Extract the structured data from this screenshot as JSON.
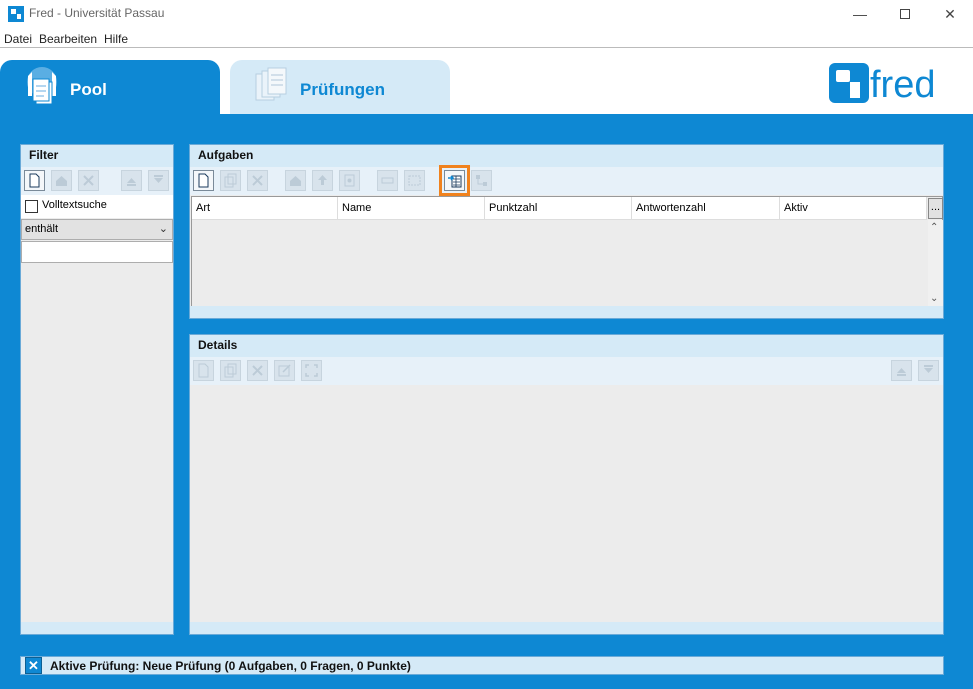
{
  "window": {
    "title": "Fred - Universität Passau",
    "minimize": "—",
    "close": "✕"
  },
  "menu": [
    "Datei",
    "Bearbeiten",
    "Hilfe"
  ],
  "tabs": [
    {
      "label": "Pool",
      "active": true
    },
    {
      "label": "Prüfungen",
      "active": false
    }
  ],
  "logo": {
    "text": "fred",
    "color": "#0e88d3"
  },
  "filter": {
    "title": "Filter",
    "fulltext_label": "Volltextsuche",
    "fulltext_checked": false,
    "mode_value": "enthält",
    "search_value": ""
  },
  "aufgaben": {
    "title": "Aufgaben",
    "columns": [
      "Art",
      "Name",
      "Punktzahl",
      "Antwortenzahl",
      "Aktiv"
    ],
    "more_label": "..."
  },
  "details": {
    "title": "Details"
  },
  "status": {
    "text": "Aktive Prüfung: Neue Prüfung (0 Aufgaben, 0 Fragen, 0 Punkte)"
  },
  "colors": {
    "accent": "#0e88d3",
    "panel_header": "#d5eaf7",
    "highlight": "#f0821e"
  }
}
